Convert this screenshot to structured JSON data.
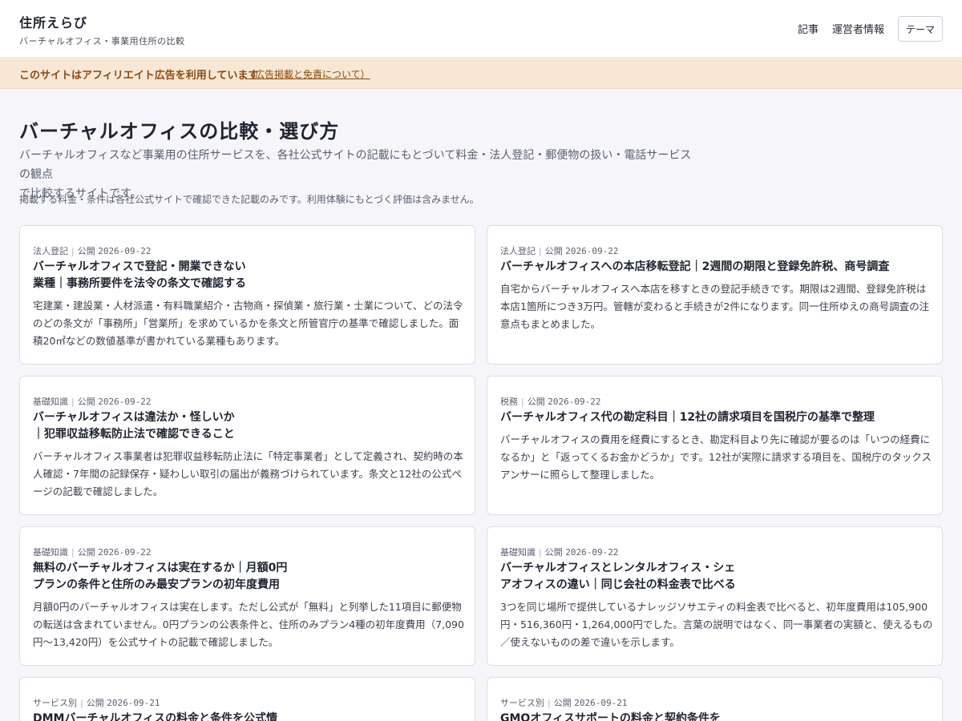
{
  "header": {
    "site_title": "住所えらび",
    "tagline": "バーチャルオフィス・事業用住所の比較",
    "nav": [
      "記事",
      "運営者情報"
    ],
    "theme_label": "テーマ"
  },
  "ad_banner": {
    "text": "このサイトはアフィリエイト広告を利用しています",
    "link": "（広告掲載と免責について）"
  },
  "main": {
    "title": "バーチャルオフィスの比較・選び方",
    "lead_1": "バーチャルオフィスなど事業用の住所サービスを、各社公式サイトの記載にもとづいて料金・法人登記・郵便物の扱い・電話サービスの観点",
    "lead_2": "で比較するサイトです。",
    "note": "掲載する料金・条件は各社公式サイトで確認できた記載のみです。利用体験にもとづく評価は含みません。"
  },
  "articles": [
    {
      "category": "法人登記",
      "date_prefix": "公開",
      "date": "2026-09-22",
      "title_1": "バーチャルオフィスで登記・開業できない",
      "title_2": "業種｜事務所要件を法令の条文で確認する",
      "excerpt": "宅建業・建設業・人材派遣・有料職業紹介・古物商・探偵業・旅行業・士業について、どの法令のどの条文が「事務所」「営業所」を求めているかを条文と所管官庁の基準で確認しました。面積20㎡などの数値基準が書かれている業種もあります。"
    },
    {
      "category": "法人登記",
      "date_prefix": "公開",
      "date": "2026-09-22",
      "title_1": "バーチャルオフィスへの本店移転登記｜2週間の期限と登録免許税、商号調査",
      "title_2": "",
      "excerpt": "自宅からバーチャルオフィスへ本店を移すときの登記手続きです。期限は2週間、登録免許税は本店1箇所につき3万円。管轄が変わると手続きが2件になります。同一住所ゆえの商号調査の注意点もまとめました。"
    },
    {
      "category": "基礎知識",
      "date_prefix": "公開",
      "date": "2026-09-22",
      "title_1": "バーチャルオフィスは違法か・怪しいか",
      "title_2": "｜犯罪収益移転防止法で確認できること",
      "excerpt": "バーチャルオフィス事業者は犯罪収益移転防止法に「特定事業者」として定義され、契約時の本人確認・7年間の記録保存・疑わしい取引の届出が義務づけられています。条文と12社の公式ページの記載で確認しました。"
    },
    {
      "category": "税務",
      "date_prefix": "公開",
      "date": "2026-09-22",
      "title_1": "バーチャルオフィス代の勘定科目｜12社の請求項目を国税庁の基準で整理",
      "title_2": "",
      "excerpt": "バーチャルオフィスの費用を経費にするとき、勘定科目より先に確認が要るのは「いつの経費になるか」と「返ってくるお金かどうか」です。12社が実際に請求する項目を、国税庁のタックスアンサーに照らして整理しました。"
    },
    {
      "category": "基礎知識",
      "date_prefix": "公開",
      "date": "2026-09-22",
      "title_1": "無料のバーチャルオフィスは実在するか｜月額0円",
      "title_2": "プランの条件と住所のみ最安プランの初年度費用",
      "excerpt": "月額0円のバーチャルオフィスは実在します。ただし公式が「無料」と列挙した11項目に郵便物の転送は含まれていません。0円プランの公表条件と、住所のみプラン4種の初年度費用（7,090円〜13,420円）を公式サイトの記載で確認しました。"
    },
    {
      "category": "基礎知識",
      "date_prefix": "公開",
      "date": "2026-09-22",
      "title_1": "バーチャルオフィスとレンタルオフィス・シェ",
      "title_2": "アオフィスの違い｜同じ会社の料金表で比べる",
      "excerpt": "3つを同じ場所で提供しているナレッジソサエティの料金表で比べると、初年度費用は105,900円・516,360円・1,264,000円でした。言葉の説明ではなく、同一事業者の実額と、使えるもの／使えないものの差で違いを示します。"
    },
    {
      "category": "サービス別",
      "date_prefix": "公開",
      "date": "2026-09-21",
      "title_1": "DMMバーチャルオフィスの料金と条件を公式情",
      "title_2": "",
      "excerpt": ""
    },
    {
      "category": "サービス別",
      "date_prefix": "公開",
      "date": "2026-09-21",
      "title_1": "GMOオフィスサポートの料金と契約条件を",
      "title_2": "",
      "excerpt": ""
    }
  ]
}
